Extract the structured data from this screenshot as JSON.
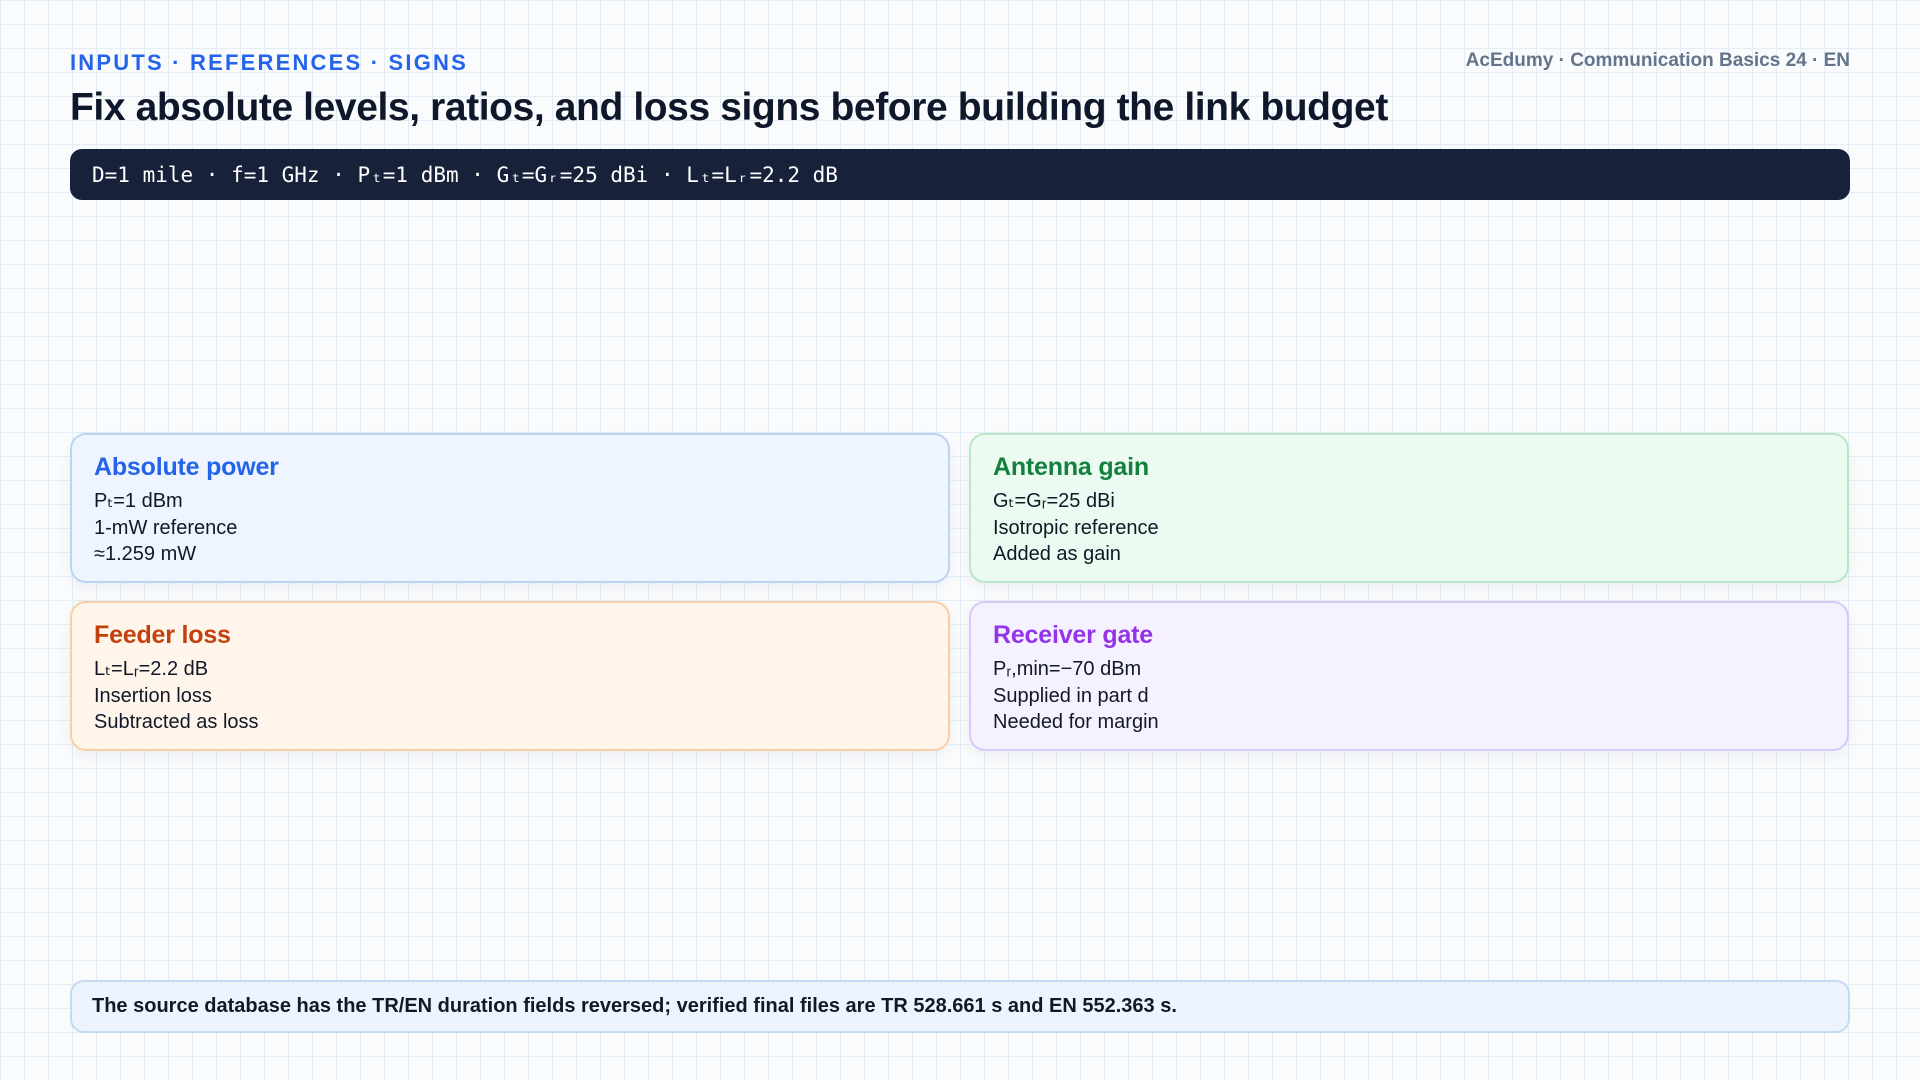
{
  "header": {
    "kicker": "INPUTS · REFERENCES · SIGNS",
    "brand": "AcEdumy · Communication Basics 24 · EN",
    "title": "Fix absolute levels, ratios, and loss signs before building the link budget"
  },
  "formula_bar": {
    "text": "D=1 mile · f=1 GHz · Pₜ=1 dBm · Gₜ=Gᵣ=25 dBi · Lₜ=Lᵣ=2.2 dB"
  },
  "cards": [
    {
      "title": "Absolute power",
      "lines": [
        "Pₜ=1 dBm",
        "1-mW reference",
        "≈1.259 mW"
      ],
      "accent": "#2563eb"
    },
    {
      "title": "Antenna gain",
      "lines": [
        "Gₜ=Gᵣ=25 dBi",
        "Isotropic reference",
        "Added as gain"
      ],
      "accent": "#15803d"
    },
    {
      "title": "Feeder loss",
      "lines": [
        "Lₜ=Lᵣ=2.2 dB",
        "Insertion loss",
        "Subtracted as loss"
      ],
      "accent": "#c2410c"
    },
    {
      "title": "Receiver gate",
      "lines": [
        "Pᵣ,min=−70 dBm",
        "Supplied in part d",
        "Needed for margin"
      ],
      "accent": "#9333ea"
    }
  ],
  "footer": {
    "note": "The source database has the TR/EN duration fields reversed; verified final files are TR 528.661 s and EN 552.363 s."
  }
}
